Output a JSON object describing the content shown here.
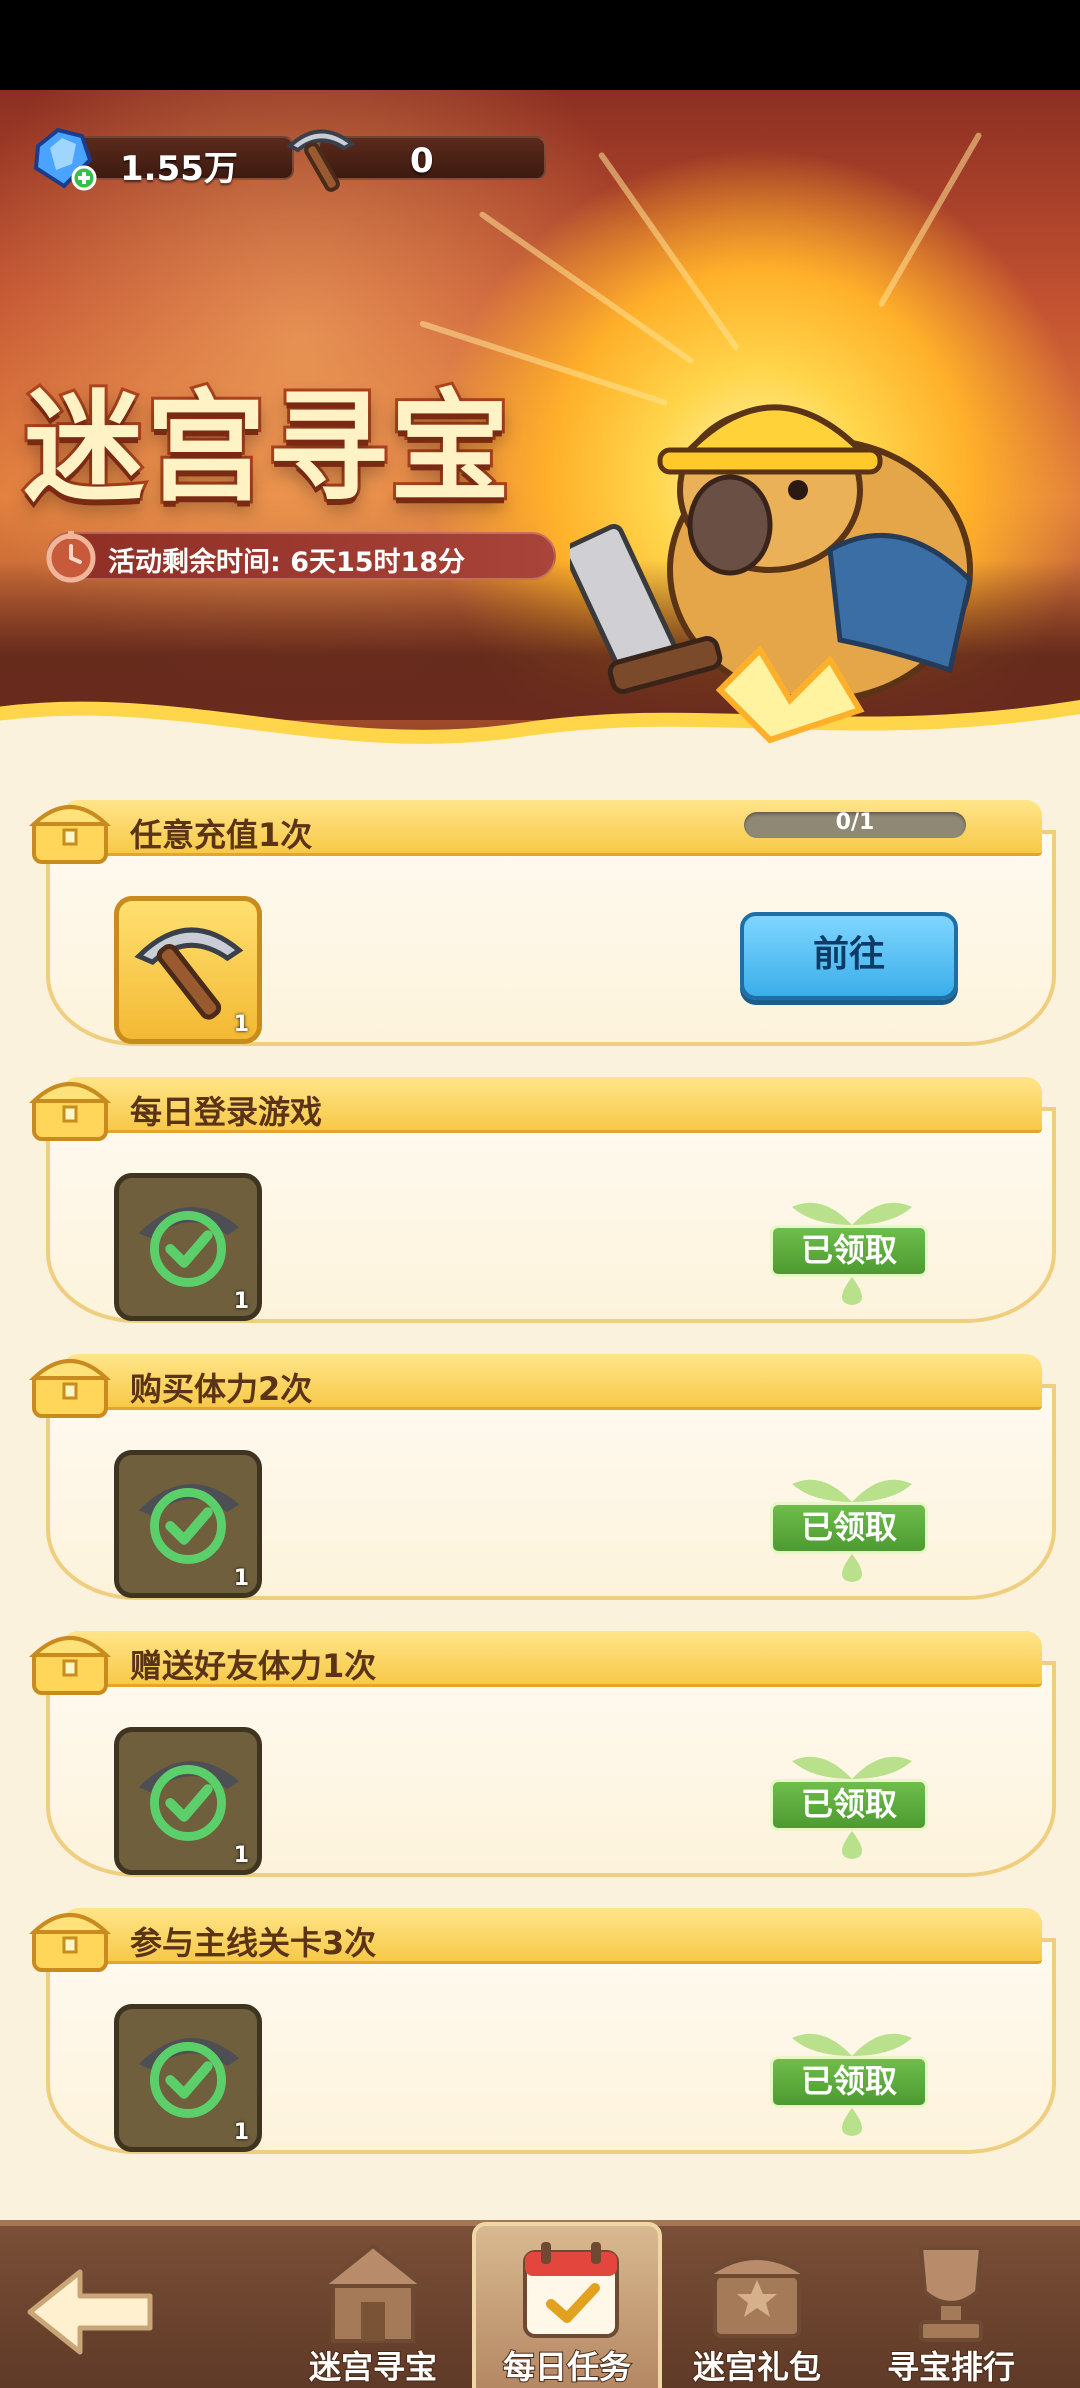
{
  "app": {
    "title": "迷宫寻宝"
  },
  "currency": {
    "gems": {
      "icon": "gem-icon",
      "value": "1.55万"
    },
    "pickaxes": {
      "icon": "pickaxe-icon",
      "value": "0"
    }
  },
  "banner": {
    "title": "迷宫寻宝",
    "timer_label": "活动剩余时间: 6天15时18分"
  },
  "tasks": [
    {
      "title": "任意充值1次",
      "progress": "0/1",
      "reward_count": "1",
      "status": "go",
      "button_label": "前往"
    },
    {
      "title": "每日登录游戏",
      "reward_count": "1",
      "status": "claimed",
      "button_label": "已领取"
    },
    {
      "title": "购买体力2次",
      "reward_count": "1",
      "status": "claimed",
      "button_label": "已领取"
    },
    {
      "title": "赠送好友体力1次",
      "reward_count": "1",
      "status": "claimed",
      "button_label": "已领取"
    },
    {
      "title": "参与主线关卡3次",
      "reward_count": "1",
      "status": "claimed",
      "button_label": "已领取"
    }
  ],
  "nav": {
    "back_icon": "back-arrow-icon",
    "tabs": [
      {
        "label": "迷宫寻宝",
        "icon": "temple-icon",
        "active": false
      },
      {
        "label": "每日任务",
        "icon": "calendar-icon",
        "active": true
      },
      {
        "label": "迷宫礼包",
        "icon": "shop-icon",
        "active": false
      },
      {
        "label": "寻宝排行",
        "icon": "trophy-icon",
        "active": false
      }
    ]
  },
  "colors": {
    "accent_gold": "#f7c948",
    "go_button": "#3aaeea",
    "claimed_green": "#4d9a31",
    "nav_bg": "#6a4330"
  }
}
